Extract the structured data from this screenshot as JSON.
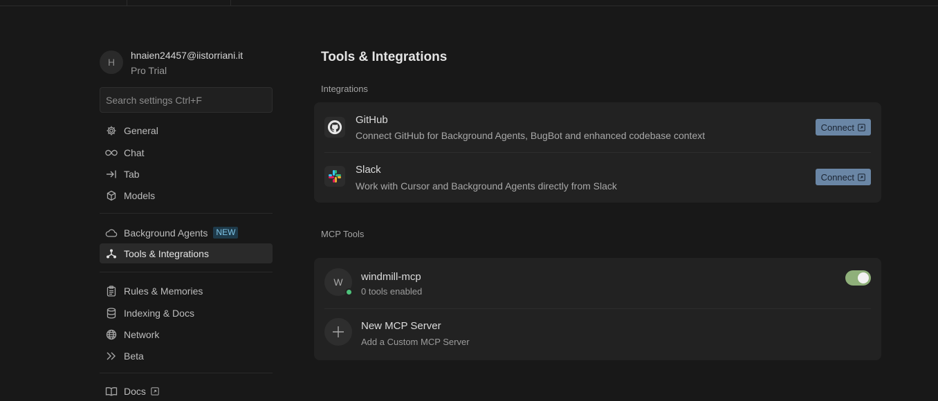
{
  "account": {
    "initial": "H",
    "email": "hnaien24457@iistorriani.it",
    "plan": "Pro Trial"
  },
  "search": {
    "placeholder": "Search settings Ctrl+F"
  },
  "sidebar": {
    "items": [
      {
        "label": "General",
        "icon": "gear-icon"
      },
      {
        "label": "Chat",
        "icon": "infinity-icon"
      },
      {
        "label": "Tab",
        "icon": "arrow-right-bar-icon"
      },
      {
        "label": "Models",
        "icon": "cube-icon"
      },
      {
        "label": "Background Agents",
        "icon": "cloud-icon",
        "badge": "NEW"
      },
      {
        "label": "Tools & Integrations",
        "icon": "nodes-icon",
        "active": true
      },
      {
        "label": "Rules & Memories",
        "icon": "clipboard-icon"
      },
      {
        "label": "Indexing & Docs",
        "icon": "database-icon"
      },
      {
        "label": "Network",
        "icon": "globe-icon"
      },
      {
        "label": "Beta",
        "icon": "double-chevron-right-icon"
      },
      {
        "label": "Docs",
        "icon": "book-icon",
        "external": true
      }
    ]
  },
  "main": {
    "title": "Tools & Integrations",
    "integrations_label": "Integrations",
    "integrations": [
      {
        "name": "GitHub",
        "description": "Connect GitHub for Background Agents, BugBot and enhanced codebase context",
        "button": "Connect",
        "icon": "github-icon"
      },
      {
        "name": "Slack",
        "description": "Work with Cursor and Background Agents directly from Slack",
        "button": "Connect",
        "icon": "slack-icon"
      }
    ],
    "mcp_label": "MCP Tools",
    "mcp_servers": [
      {
        "initial": "W",
        "name": "windmill-mcp",
        "status": "0 tools enabled",
        "enabled": true
      }
    ],
    "new_server": {
      "title": "New MCP Server",
      "subtitle": "Add a Custom MCP Server"
    }
  },
  "colors": {
    "background": "#181818",
    "card": "#222222",
    "connect_button": "#6a86a5",
    "toggle_on": "#8fb07a",
    "status_online": "#4ec27b",
    "badge_bg": "#1e3a4a",
    "badge_text": "#7fc6e8"
  }
}
